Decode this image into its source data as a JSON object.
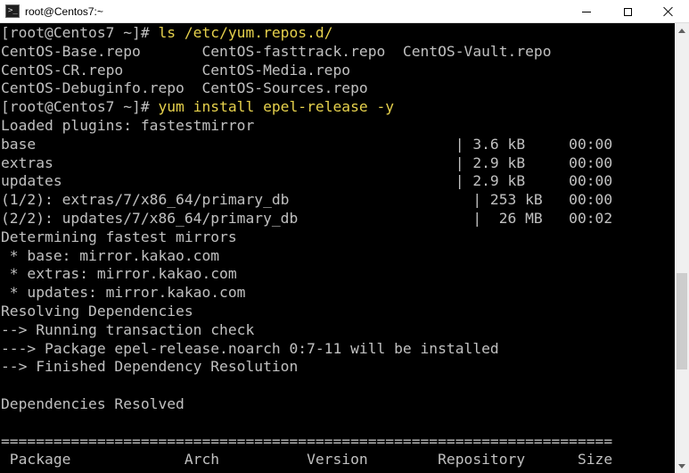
{
  "window": {
    "title": "root@Centos7:~",
    "icon": "terminal-icon",
    "controls": {
      "minimize": "minimize-icon",
      "maximize": "maximize-icon",
      "close": "close-icon"
    }
  },
  "colors": {
    "background": "#000000",
    "text": "#c0c0c0",
    "command": "#e5d04c",
    "titlebar": "#ffffff"
  },
  "terminal": {
    "prompt": "[root@Centos7 ~]# ",
    "commands": [
      "ls /etc/yum.repos.d/",
      "yum install epel-release -y"
    ],
    "ls_output": [
      "CentOS-Base.repo       CentOS-fasttrack.repo  CentOS-Vault.repo",
      "CentOS-CR.repo         CentOS-Media.repo",
      "CentOS-Debuginfo.repo  CentOS-Sources.repo"
    ],
    "yum_output": [
      "Loaded plugins: fastestmirror",
      "base                                                | 3.6 kB     00:00",
      "extras                                              | 2.9 kB     00:00",
      "updates                                             | 2.9 kB     00:00",
      "(1/2): extras/7/x86_64/primary_db                     | 253 kB   00:00",
      "(2/2): updates/7/x86_64/primary_db                    |  26 MB   00:02",
      "Determining fastest mirrors",
      " * base: mirror.kakao.com",
      " * extras: mirror.kakao.com",
      " * updates: mirror.kakao.com",
      "Resolving Dependencies",
      "--> Running transaction check",
      "---> Package epel-release.noarch 0:7-11 will be installed",
      "--> Finished Dependency Resolution",
      "",
      "Dependencies Resolved",
      "",
      "======================================================================",
      " Package             Arch          Version        Repository      Size"
    ]
  }
}
